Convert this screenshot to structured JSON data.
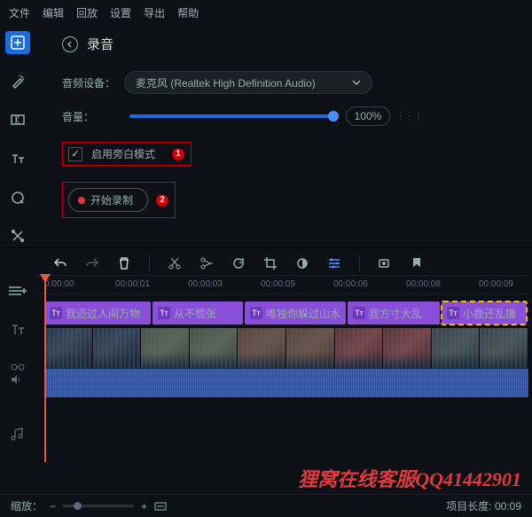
{
  "menu": {
    "file": "文件",
    "edit": "编辑",
    "playback": "回放",
    "settings": "设置",
    "export": "导出",
    "help": "帮助"
  },
  "panel": {
    "title": "录音",
    "device_label": "音频设备：",
    "device_value": "麦克风 (Realtek High Definition Audio)",
    "volume_label": "音量：",
    "volume_pct": "100%",
    "narration_label": "启用旁白模式",
    "record_label": "开始录制",
    "badge1": "1",
    "badge2": "2"
  },
  "timeline": {
    "ticks": [
      "0:00:00",
      "00:00:01",
      "00:00:03",
      "00:00:05",
      "00:00:06",
      "00:00:08",
      "00:00:09"
    ],
    "titles": [
      "我迈过人间万物",
      "从不慌张",
      "唯独你躲过山水",
      "我方寸大乱",
      "小鹿还乱撞"
    ]
  },
  "footer": {
    "zoom_label": "缩放：",
    "length_label": "项目长度:",
    "length_value": "00:09"
  },
  "watermark": "狸窝在线客服QQ41442901"
}
